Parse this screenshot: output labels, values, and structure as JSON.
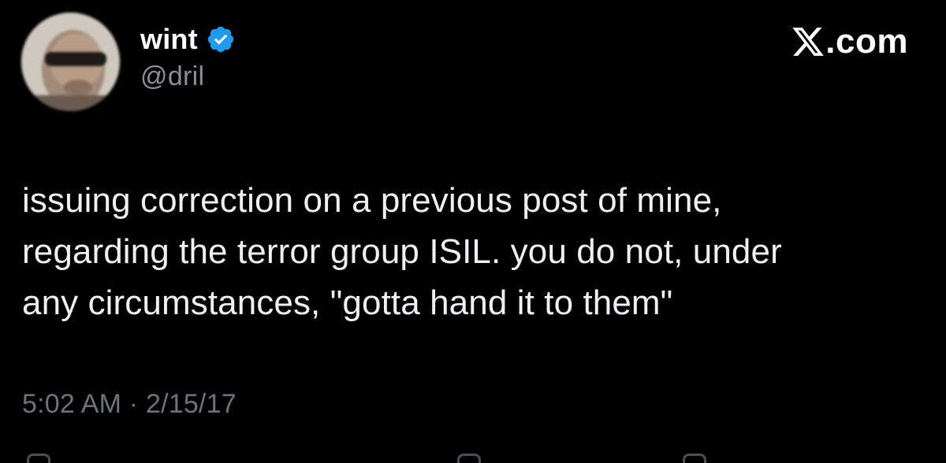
{
  "author": {
    "display_name": "wint",
    "handle": "@dril",
    "verified_icon": "verified-badge-icon",
    "verified_color": "#1d9bf0"
  },
  "brand": {
    "logo_icon": "x-logo-icon",
    "text": ".com"
  },
  "post": {
    "text": "issuing correction on a previous post of mine,\nregarding the terror group ISIL. you do not, under\nany circumstances, \"gotta hand it to them\"",
    "timestamp": "5:02 AM · 2/15/17"
  },
  "actions": [
    {
      "name": "reply",
      "icon": "reply-icon"
    },
    {
      "name": "repost",
      "icon": "repost-icon"
    },
    {
      "name": "like",
      "icon": "like-icon"
    }
  ],
  "colors": {
    "background": "#000000",
    "text": "#e7e9ea",
    "secondary": "#71767b",
    "accent": "#1d9bf0"
  }
}
